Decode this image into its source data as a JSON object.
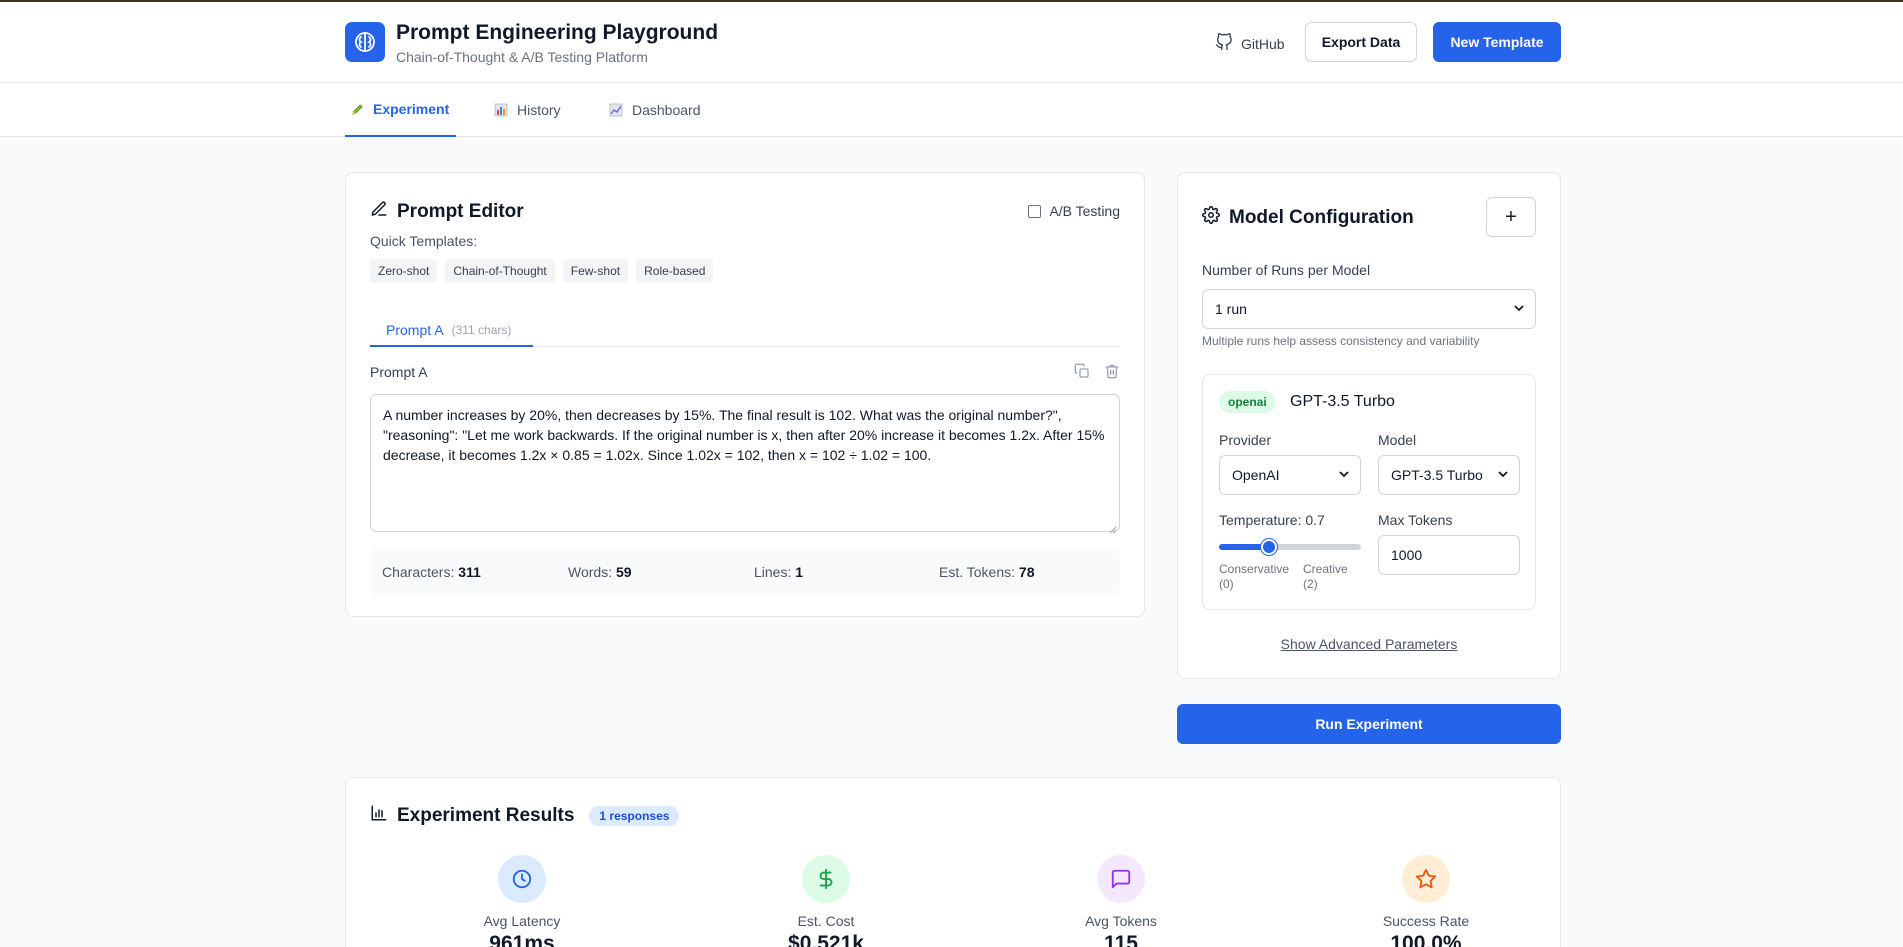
{
  "header": {
    "title": "Prompt Engineering Playground",
    "subtitle": "Chain-of-Thought & A/B Testing Platform",
    "github_label": "GitHub",
    "export_label": "Export Data",
    "new_template_label": "New Template"
  },
  "nav": {
    "tabs": [
      {
        "label": "Experiment",
        "icon": "pencil-icon",
        "active": true
      },
      {
        "label": "History",
        "icon": "bar-chart-icon",
        "active": false
      },
      {
        "label": "Dashboard",
        "icon": "trend-chart-icon",
        "active": false
      }
    ]
  },
  "editor": {
    "title": "Prompt Editor",
    "ab_testing_label": "A/B Testing",
    "ab_testing_checked": false,
    "quick_templates_label": "Quick Templates:",
    "templates": [
      "Zero-shot",
      "Chain-of-Thought",
      "Few-shot",
      "Role-based"
    ],
    "prompt_tab_label": "Prompt A",
    "prompt_tab_count": "(311 chars)",
    "field_label": "Prompt A",
    "prompt_text": "A number increases by 20%, then decreases by 15%. The final result is 102. What was the original number?\", \"reasoning\": \"Let me work backwards. If the original number is x, then after 20% increase it becomes 1.2x. After 15% decrease, it becomes 1.2x × 0.85 = 1.02x. Since 1.02x = 102, then x = 102 ÷ 1.02 = 100.",
    "stats": {
      "characters_label": "Characters:",
      "characters": "311",
      "words_label": "Words:",
      "words": "59",
      "lines_label": "Lines:",
      "lines": "1",
      "tokens_label": "Est. Tokens:",
      "tokens": "78"
    }
  },
  "config": {
    "title": "Model Configuration",
    "add_label": "+",
    "runs_label": "Number of Runs per Model",
    "runs_value": "1 run",
    "runs_hint": "Multiple runs help assess consistency and variability",
    "model": {
      "provider_badge": "openai",
      "name": "GPT-3.5 Turbo",
      "provider_label": "Provider",
      "provider_value": "OpenAI",
      "model_label": "Model",
      "model_value": "GPT-3.5 Turbo",
      "temperature_label": "Temperature: 0.7",
      "temperature_fraction": 0.35,
      "cap_low": "Conservative (0)",
      "cap_high": "Creative (2)",
      "max_tokens_label": "Max Tokens",
      "max_tokens_value": "1000"
    },
    "advanced_label": "Show Advanced Parameters"
  },
  "run_button_label": "Run Experiment",
  "results": {
    "title": "Experiment Results",
    "badge": "1 responses",
    "metrics": [
      {
        "label": "Avg Latency",
        "value": "961ms",
        "icon": "clock-icon",
        "bg": "#dbeafe",
        "fg": "#2563eb"
      },
      {
        "label": "Est. Cost",
        "value": "$0.521k",
        "icon": "dollar-icon",
        "bg": "#dcfce7",
        "fg": "#16a34a"
      },
      {
        "label": "Avg Tokens",
        "value": "115",
        "icon": "message-icon",
        "bg": "#f3e8ff",
        "fg": "#9333ea"
      },
      {
        "label": "Success Rate",
        "value": "100.0%",
        "icon": "star-icon",
        "bg": "#ffedd5",
        "fg": "#ea580c"
      }
    ]
  },
  "colors": {
    "accent": "#2563eb"
  }
}
